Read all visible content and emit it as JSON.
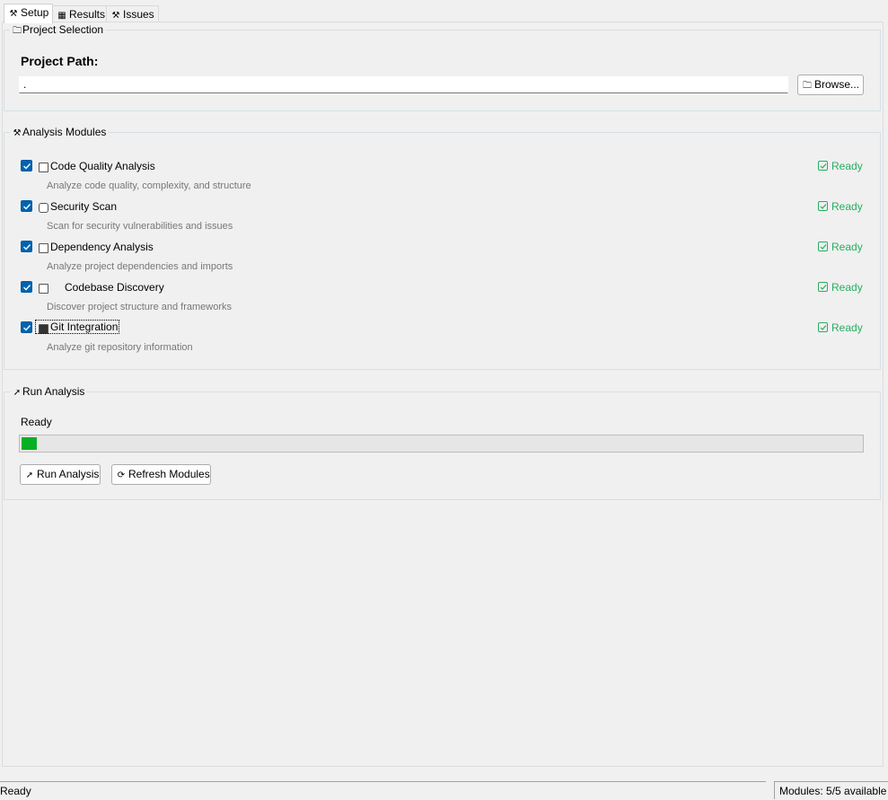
{
  "tabs": [
    {
      "label": "Setup",
      "icon": "wrench-icon"
    },
    {
      "label": "Results",
      "icon": "chart-icon"
    },
    {
      "label": "Issues",
      "icon": "wrench-icon"
    }
  ],
  "project": {
    "legend": "Project Selection",
    "path_label": "Project Path:",
    "path_value": ".",
    "browse_label": "Browse..."
  },
  "modules": {
    "legend": "Analysis Modules",
    "items": [
      {
        "title": "Code Quality Analysis",
        "description": "Analyze code quality, complexity, and structure",
        "status": "Ready",
        "checked": true,
        "icon": "clipboard-icon"
      },
      {
        "title": "Security Scan",
        "description": "Scan for security vulnerabilities and issues",
        "status": "Ready",
        "checked": true,
        "icon": "lock-icon"
      },
      {
        "title": "Dependency Analysis",
        "description": "Analyze project dependencies and imports",
        "status": "Ready",
        "checked": true,
        "icon": "package-icon"
      },
      {
        "title": "Codebase Discovery",
        "description": "Discover project structure and frameworks",
        "status": "Ready",
        "checked": true,
        "icon": "map-icon"
      },
      {
        "title": "Git Integration",
        "description": "Analyze git repository information",
        "status": "Ready",
        "checked": true,
        "icon": "chart-icon"
      }
    ],
    "status_color": "#27ae60"
  },
  "run": {
    "legend": "Run Analysis",
    "status_text": "Ready",
    "progress_fraction": 0.018,
    "progress_color": "#06b025",
    "run_button_label": "Run Analysis",
    "refresh_button_label": "Refresh Modules"
  },
  "statusbar": {
    "left_text": "Ready",
    "right_text": "Modules: 5/5 available"
  },
  "colors": {
    "checkbox": "#0063b1",
    "background": "#f0f0f0"
  }
}
